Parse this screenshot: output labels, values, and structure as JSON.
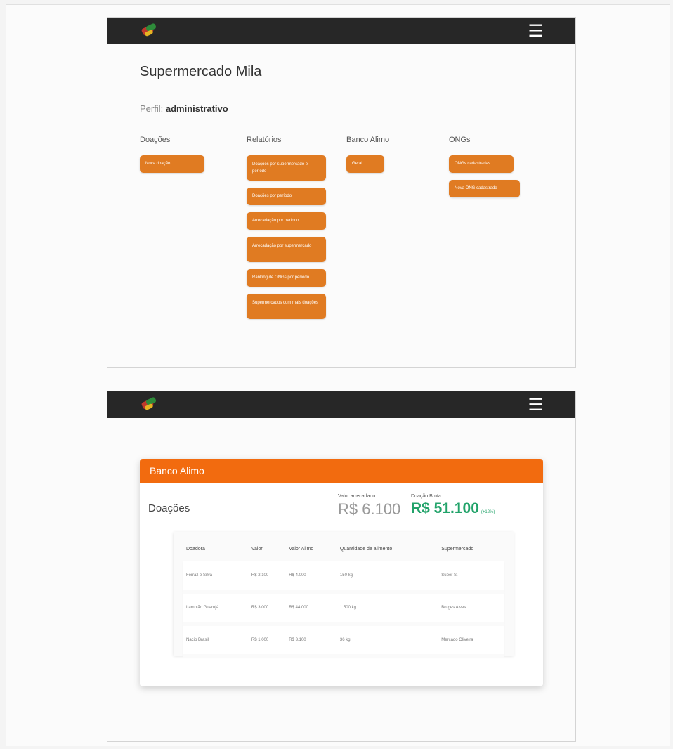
{
  "screen1": {
    "store_name": "Supermercado Mila",
    "profile_prefix": "Perfil:",
    "profile_value": "administrativo",
    "menu_icon": "☰",
    "columns": [
      {
        "heading": "Doações",
        "buttons": [
          "Nova doação"
        ]
      },
      {
        "heading": "Relatórios",
        "buttons": [
          "Doações por supermercado e período",
          "Doações por período",
          "Arrecadação por período",
          "Arrecadação por supermercado",
          "Ranking de ONGs por período",
          "Supermercados com mais doações"
        ]
      },
      {
        "heading": "Banco Alimo",
        "buttons": [
          "Geral"
        ]
      },
      {
        "heading": "ONGs",
        "buttons": [
          "ONGs cadastradas",
          "Nova ONG cadastrada"
        ]
      }
    ]
  },
  "screen2": {
    "menu_icon": "☰",
    "card_title": "Banco Alimo",
    "section_title": "Doações",
    "stat_arrecadado": {
      "label": "Valor arrecadado",
      "value": "R$ 6.100"
    },
    "stat_doado": {
      "label": "Doação Bruta",
      "value": "R$ 51.100",
      "suffix": "(+12%)"
    },
    "table": {
      "headers": [
        "Doadora",
        "Valor",
        "Valor Alimo",
        "Quantidade de alimento",
        "Supermercado"
      ],
      "rows": [
        [
          "Ferraz e Silva",
          "R$ 2.100",
          "R$ 4.000",
          "150 kg",
          "Super S."
        ],
        [
          "Lampião Guarujá",
          "R$ 3.000",
          "R$ 44.000",
          "1.500 kg",
          "Borges Alves"
        ],
        [
          "Nacib Brasil",
          "R$ 1.000",
          "R$ 3.100",
          "36 kg",
          "Mercado Oliveira"
        ]
      ]
    }
  },
  "colors": {
    "topbar": "#272727",
    "button_orange": "#e07b22",
    "card_header_orange": "#f26b0f",
    "green_value": "#22a36a"
  },
  "icons": {
    "logo": "colored-boxes-logo",
    "menu": "hamburger-menu-icon"
  }
}
